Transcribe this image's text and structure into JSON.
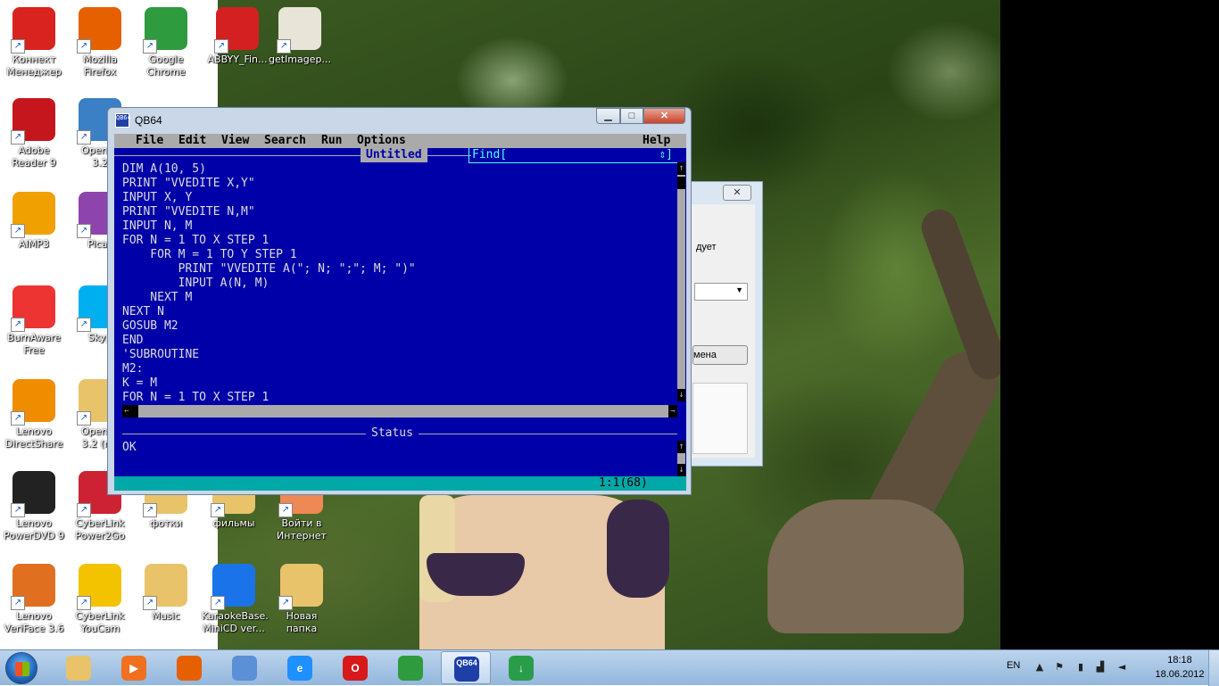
{
  "desktop": {
    "icons": [
      {
        "label": "Коннект\nМенеджер",
        "icon": "connect-manager-icon",
        "color": "#d8231f"
      },
      {
        "label": "Mozilla\nFirefox",
        "icon": "firefox-icon",
        "color": "#e66000"
      },
      {
        "label": "Google\nChrome",
        "icon": "chrome-icon",
        "color": "#2e9b3e"
      },
      {
        "label": "ABBYY_Fin...",
        "icon": "abbyy-icon",
        "color": "#d42020"
      },
      {
        "label": "getImagep...",
        "icon": "document-icon",
        "color": "#e8e4d8"
      },
      {
        "label": "Adobe\nReader 9",
        "icon": "adobe-reader-icon",
        "color": "#c5161d"
      },
      {
        "label": "OpenOf\n3.2",
        "icon": "openoffice-icon",
        "color": "#3b7fc4"
      },
      {
        "label": "AIMP3",
        "icon": "aimp-icon",
        "color": "#f0a000"
      },
      {
        "label": "Picas",
        "icon": "picasa-icon",
        "color": "#8e44ad"
      },
      {
        "label": "BurnAware\nFree",
        "icon": "burnaware-icon",
        "color": "#e33"
      },
      {
        "label": "Skyp",
        "icon": "skype-icon",
        "color": "#00aff0"
      },
      {
        "label": "Lenovo\nDirectShare",
        "icon": "directshare-icon",
        "color": "#f08c00"
      },
      {
        "label": "OpenOf\n3.2 (ru)",
        "icon": "folder-icon",
        "color": "#e8c36a"
      },
      {
        "label": "Lenovo\nPowerDVD 9",
        "icon": "powerdvd-icon",
        "color": "#222"
      },
      {
        "label": "CyberLink\nPower2Go",
        "icon": "power2go-icon",
        "color": "#c23"
      },
      {
        "label": "фотки",
        "icon": "folder-icon",
        "color": "#e8c36a"
      },
      {
        "label": "фильмы",
        "icon": "folder-icon",
        "color": "#e8c36a"
      },
      {
        "label": "Войти в\nИнтернет",
        "icon": "internet-icon",
        "color": "#e85"
      },
      {
        "label": "Lenovo\nVeriFace 3.6",
        "icon": "veriface-icon",
        "color": "#e07020"
      },
      {
        "label": "CyberLink\nYouCam",
        "icon": "youcam-icon",
        "color": "#f3c300"
      },
      {
        "label": "Music",
        "icon": "folder-icon",
        "color": "#e8c36a"
      },
      {
        "label": "KaraokeBase.\nMiniCD ver...",
        "icon": "karaoke-icon",
        "color": "#1a73e8"
      },
      {
        "label": "Новая папка",
        "icon": "folder-icon",
        "color": "#e8c36a"
      }
    ]
  },
  "bg_dialog": {
    "close_label": "✕",
    "text": "дует",
    "combo_arrow": "▼",
    "button_label": "мена"
  },
  "qb": {
    "title": "QB64",
    "icon_text": "QB64",
    "window_buttons": {
      "min": "▁",
      "max": "□",
      "close": "✕"
    },
    "menu": [
      "File",
      "Edit",
      "View",
      "Search",
      "Run",
      "Options"
    ],
    "help": "Help",
    "editor_title": "Untitled",
    "find_label": "Find[",
    "find_ctrl": "⇕]",
    "code": [
      "DIM A(10, 5)",
      "PRINT \"VVEDITE X,Y\"",
      "INPUT X, Y",
      "PRINT \"VVEDITE N,M\"",
      "INPUT N, M",
      "FOR N = 1 TO X STEP 1",
      "    FOR M = 1 TO Y STEP 1",
      "        PRINT \"VVEDITE A(\"; N; \";\"; M; \")\"",
      "        INPUT A(N, M)",
      "    NEXT M",
      "NEXT N",
      "GOSUB M2",
      "END",
      "'SUBROUTINE",
      "M2:",
      "K = M",
      "FOR N = 1 TO X STEP 1"
    ],
    "scroll_up": "↑",
    "scroll_down": "↓",
    "scroll_left": "←",
    "scroll_right": "→",
    "status_title": "Status",
    "status_text": "OK",
    "cursor_pos": "1:1(68)"
  },
  "taskbar": {
    "buttons": [
      {
        "name": "explorer",
        "icon": "explorer-icon",
        "text": "",
        "color": "#e8c36a"
      },
      {
        "name": "media-player",
        "icon": "media-player-icon",
        "text": "▶",
        "color": "#f07020"
      },
      {
        "name": "firefox",
        "icon": "firefox-icon",
        "text": "",
        "color": "#e66000"
      },
      {
        "name": "ie-like",
        "icon": "app-icon",
        "text": "",
        "color": "#5b8fd6"
      },
      {
        "name": "internet-explorer",
        "icon": "internet-explorer-icon",
        "text": "e",
        "color": "#1e90ff"
      },
      {
        "name": "opera",
        "icon": "opera-icon",
        "text": "O",
        "color": "#d7191c"
      },
      {
        "name": "chrome",
        "icon": "chrome-icon",
        "text": "",
        "color": "#2e9b3e"
      },
      {
        "name": "qb64",
        "icon": "qb64-icon",
        "text": "QB64",
        "color": "#1e3fa8"
      },
      {
        "name": "download",
        "icon": "download-icon",
        "text": "↓",
        "color": "#2a9d4a"
      }
    ],
    "lang": "EN",
    "tray_icons": [
      "▲",
      "⚑",
      "▮",
      "▟",
      "◄"
    ],
    "time": "18:18",
    "date": "18.06.2012"
  }
}
